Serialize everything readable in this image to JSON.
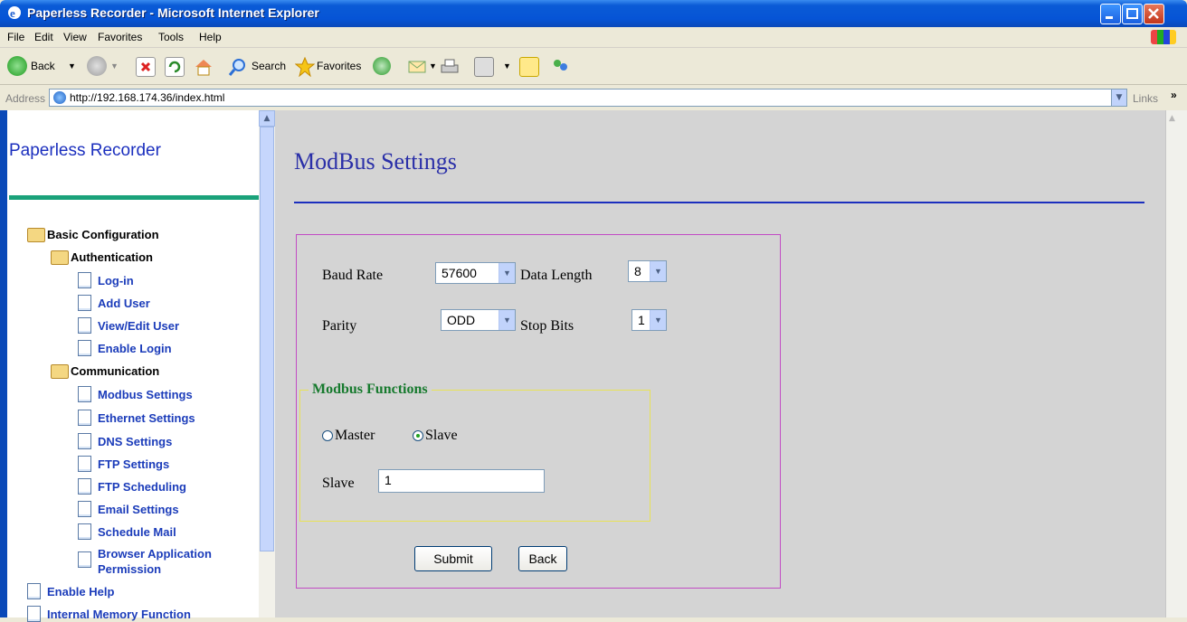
{
  "window": {
    "title": "Paperless Recorder - Microsoft Internet Explorer"
  },
  "menu": [
    "File",
    "Edit",
    "View",
    "Favorites",
    "Tools",
    "Help"
  ],
  "toolbar": {
    "back": "Back",
    "search": "Search",
    "favorites": "Favorites"
  },
  "address": {
    "label": "Address",
    "url": "http://192.168.174.36/index.html",
    "links": "Links"
  },
  "sidebar": {
    "title": "Paperless Recorder",
    "tree": [
      {
        "label": "Basic Configuration",
        "type": "folder"
      },
      {
        "label": "Authentication",
        "type": "folder"
      },
      {
        "label": "Log-in",
        "type": "link"
      },
      {
        "label": "Add User",
        "type": "link"
      },
      {
        "label": "View/Edit User",
        "type": "link"
      },
      {
        "label": "Enable Login",
        "type": "link"
      },
      {
        "label": "Communication",
        "type": "folder"
      },
      {
        "label": "Modbus Settings",
        "type": "link"
      },
      {
        "label": "Ethernet Settings",
        "type": "link"
      },
      {
        "label": "DNS Settings",
        "type": "link"
      },
      {
        "label": "FTP Settings",
        "type": "link"
      },
      {
        "label": "FTP Scheduling",
        "type": "link"
      },
      {
        "label": "Email Settings",
        "type": "link"
      },
      {
        "label": "Schedule Mail",
        "type": "link"
      },
      {
        "label": "Browser Application",
        "type": "link"
      },
      {
        "label": "Permission",
        "type": "link"
      },
      {
        "label": "Enable Help",
        "type": "link"
      },
      {
        "label": "Internal Memory Function",
        "type": "link"
      }
    ]
  },
  "main": {
    "title": "ModBus Settings",
    "baud_rate_label": "Baud Rate",
    "baud_rate_value": "57600",
    "data_length_label": "Data Length",
    "data_length_value": "8",
    "parity_label": "Parity",
    "parity_value": "ODD",
    "stop_bits_label": "Stop Bits",
    "stop_bits_value": "1",
    "functions_legend": "Modbus Functions",
    "master_label": "Master",
    "slave_radio_label": "Slave",
    "selected_mode": "Slave",
    "slave_id_label": "Slave",
    "slave_id_value": "1",
    "submit_label": "Submit",
    "back_label": "Back"
  }
}
